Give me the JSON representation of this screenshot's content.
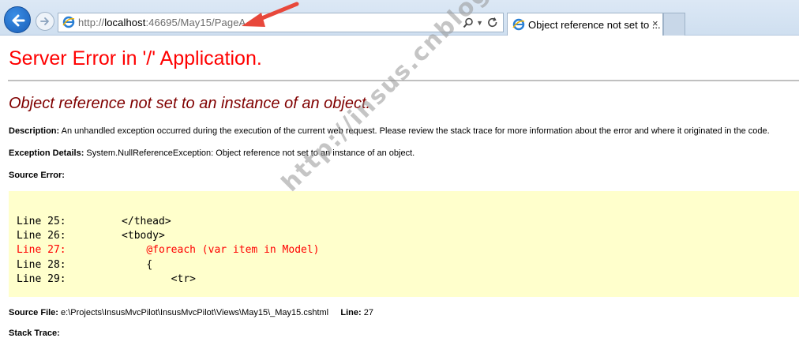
{
  "browser": {
    "url_prefix": "http://",
    "url_host": "localhost",
    "url_rest": ":46695/May15/PageA",
    "tab_title": "Object reference not set to ...",
    "tab_close": "×"
  },
  "error_page": {
    "title": "Server Error in '/' Application.",
    "message": "Object reference not set to an instance of an object.",
    "description_label": "Description:",
    "description_text": "An unhandled exception occurred during the execution of the current web request. Please review the stack trace for more information about the error and where it originated in the code.",
    "exception_label": "Exception Details:",
    "exception_text": "System.NullReferenceException: Object reference not set to an instance of an object.",
    "source_error_label": "Source Error:",
    "code_lines": [
      "Line 25:         </thead>",
      "Line 26:         <tbody>",
      "Line 27:             @foreach (var item in Model)",
      "Line 28:             {",
      "Line 29:                 <tr>"
    ],
    "source_file_label": "Source File:",
    "source_file_value": "e:\\Projects\\InsusMvcPilot\\InsusMvcPilot\\Views\\May15\\_May15.cshtml",
    "line_label": "Line:",
    "line_value": "27",
    "stack_trace_label": "Stack Trace:"
  },
  "watermark": "http://insus.cnblogs.com",
  "colors": {
    "title_red": "#ff0000",
    "message_maroon": "#800000",
    "source_bg": "#ffffcc",
    "annotation_arrow": "#e8483b"
  }
}
